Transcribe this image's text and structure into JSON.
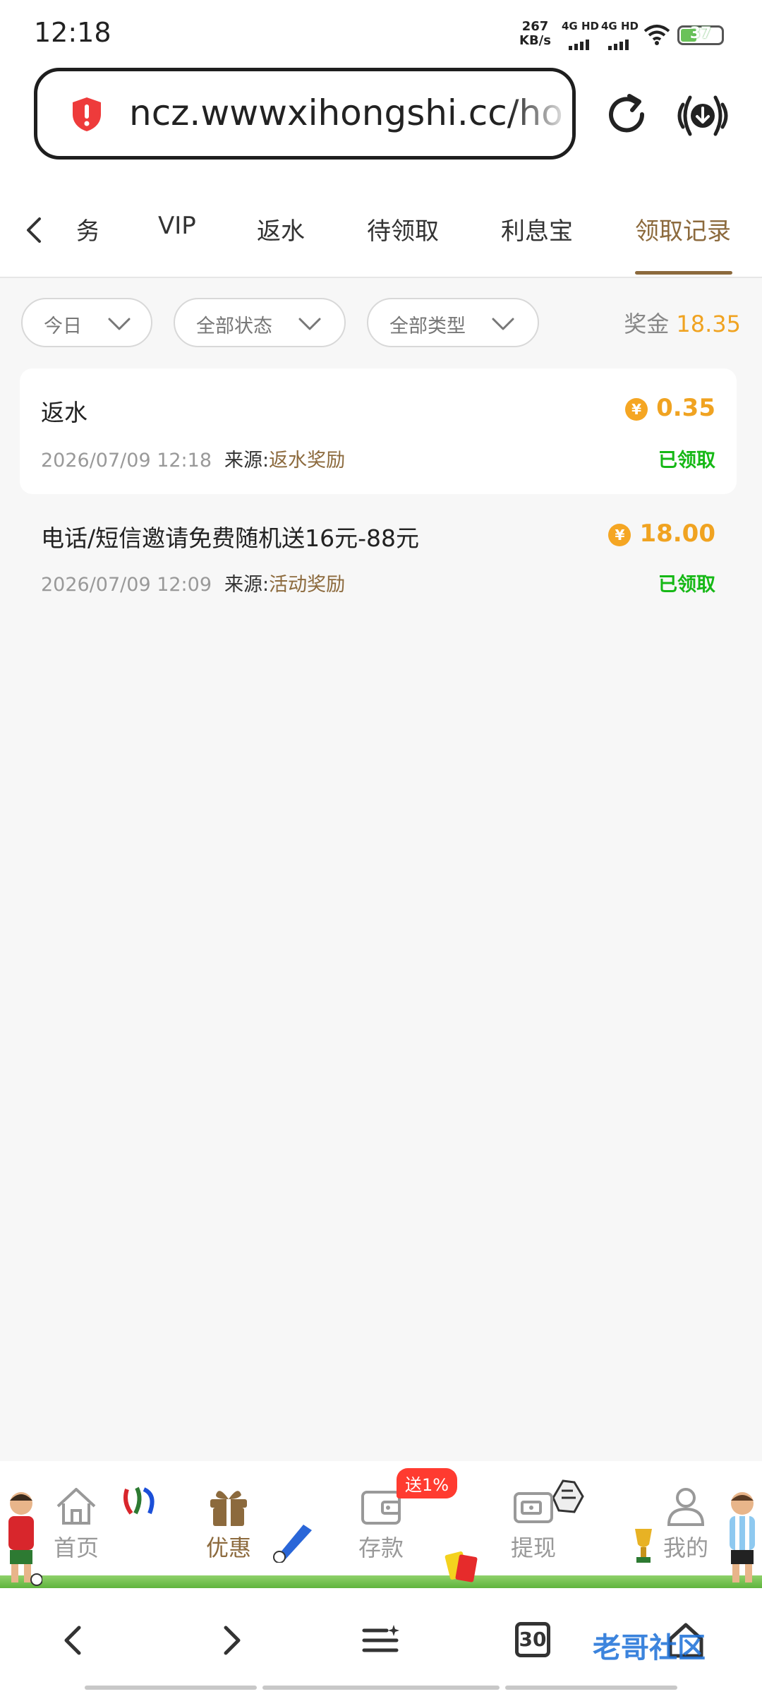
{
  "status_bar": {
    "time": "12:18",
    "speed_value": "267",
    "speed_unit": "KB/s",
    "network1": "4G HD",
    "network2": "4G HD",
    "battery": "37"
  },
  "browser": {
    "url": "ncz.wwwxihongshi.cc/ho",
    "icons": [
      "shield-alert-icon",
      "reload-icon",
      "download-icon"
    ]
  },
  "tabs": {
    "items": [
      {
        "label": "务"
      },
      {
        "label": "VIP"
      },
      {
        "label": "返水"
      },
      {
        "label": "待领取"
      },
      {
        "label": "利息宝"
      },
      {
        "label": "领取记录",
        "active": true
      }
    ]
  },
  "filters": {
    "date": "今日",
    "status": "全部状态",
    "type": "全部类型"
  },
  "bonus": {
    "label": "奖金",
    "value": "18.35"
  },
  "records": [
    {
      "title": "返水",
      "datetime": "2026/07/09 12:18",
      "source_label": "来源:",
      "source": "返水奖励",
      "amount": "0.35",
      "status": "已领取"
    },
    {
      "title": "电话/短信邀请免费随机送16元-88元",
      "datetime": "2026/07/09 12:09",
      "source_label": "来源:",
      "source": "活动奖励",
      "amount": "18.00",
      "status": "已领取"
    }
  ],
  "coin_symbol": "¥",
  "app_nav": {
    "items": [
      {
        "label": "首页",
        "icon": "home-icon"
      },
      {
        "label": "优惠",
        "icon": "gift-icon",
        "active": true
      },
      {
        "label": "存款",
        "icon": "wallet-icon"
      },
      {
        "label": "提现",
        "icon": "withdraw-icon"
      },
      {
        "label": "我的",
        "icon": "user-icon"
      }
    ],
    "deposit_badge": "送1%"
  },
  "browser_toolbar": {
    "tab_count": "30",
    "icons": [
      "back-icon",
      "forward-icon",
      "menu-icon",
      "tabs-icon",
      "home-icon"
    ]
  },
  "watermark": "老哥社区",
  "colors": {
    "accent": "#8c6a3d",
    "gold": "#f0a321",
    "success": "#16b816",
    "badge": "#ff3b30"
  }
}
